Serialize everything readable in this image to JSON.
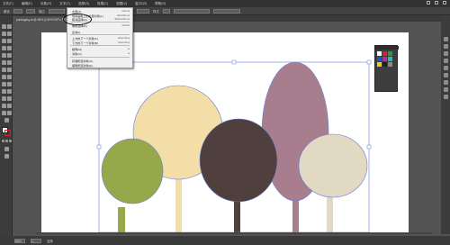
{
  "menubar": {
    "items": [
      "文件(F)",
      "编辑(E)",
      "对象(O)",
      "文字(T)",
      "选择(S)",
      "效果(C)",
      "视图(V)",
      "窗口(W)",
      "帮助(H)"
    ]
  },
  "controlbar": {
    "label1": "路径",
    "label2": "描边",
    "label3": "基本",
    "label4": "不透明度",
    "label5": "样式"
  },
  "document_tab": "packaging.ai @ 66% (CMYK/GPU 预览)",
  "edit_menu": {
    "items": [
      {
        "label": "全部(A)",
        "shortcut": "Ctrl+A"
      },
      {
        "label": "现用画板上的全部对象(L)",
        "shortcut": "Alt+Ctrl+A"
      },
      {
        "label": "取消选择(D)",
        "shortcut": "Shift+Ctrl+A"
      },
      {
        "label": "重新选择(R)",
        "shortcut": "Ctrl+6"
      },
      {
        "label": "反向(I)",
        "shortcut": ""
      },
      {
        "label": "上方的下一个对象(V)",
        "shortcut": "Alt+Ctrl+]"
      },
      {
        "label": "下方的下一个对象(B)",
        "shortcut": "Alt+Ctrl+["
      },
      {
        "label": "相同(M)",
        "shortcut": "▸"
      },
      {
        "label": "对象(O)",
        "shortcut": "▸"
      },
      {
        "label": "存储所选对象(S)...",
        "shortcut": ""
      },
      {
        "label": "编辑所选对象(E)...",
        "shortcut": ""
      }
    ]
  },
  "statusbar": {
    "zoom": "66%",
    "page": "1",
    "tool": "选择"
  },
  "colors": {
    "tree_green": "#97a84a",
    "tree_cream": "#f3dea8",
    "tree_brown": "#4f3f3d",
    "tree_mauve": "#a87e8e",
    "tree_light": "#e1d9c2",
    "selection": "#6a7ed8"
  }
}
